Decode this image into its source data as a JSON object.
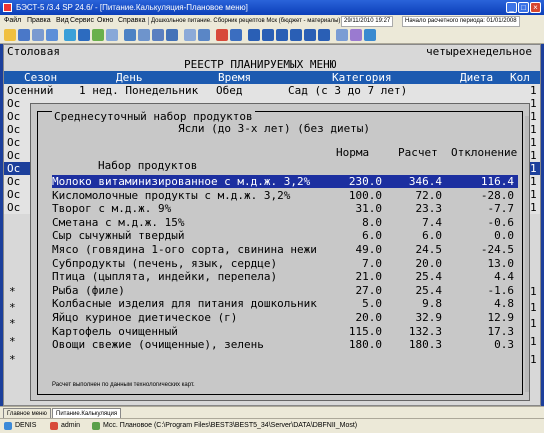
{
  "window": {
    "title": "БЭСТ-5 /3.4 SP 24.6/ - [Питание.Калькуляция-Плановое меню]"
  },
  "menu": {
    "items": [
      "Файл",
      "Правка",
      "Вид",
      "Сервис",
      "Окно",
      "Справка"
    ],
    "context": "Дошкольное питание. Сборник рецептов Мск (бюджет - материалы)",
    "date_info": "29/11/2010 19:27",
    "period_info": "Начало расчетного периода: 01/01/2008"
  },
  "header": {
    "left": "Столовая",
    "right": "четырехнедельное",
    "title": "РЕЕСТР ПЛАНИРУЕМЫХ МЕНЮ"
  },
  "columns": [
    "Сезон",
    "День",
    "Время",
    "Категория",
    "Диета",
    "Кол"
  ],
  "first_row": {
    "season": "Осенний",
    "day": "1 нед. Понедельник",
    "time": "Обед",
    "category": "Сад (с 3 до 7 лет)",
    "count": "1"
  },
  "bg_rows": [
    {
      "season": "Ос",
      "count": "1"
    },
    {
      "season": "Ос",
      "count": "1"
    },
    {
      "season": "Ос",
      "count": "1"
    },
    {
      "season": "Ос",
      "count": "1"
    },
    {
      "season": "Ос",
      "count": "1"
    },
    {
      "season": "Ос",
      "count": "1"
    },
    {
      "season": "Ос",
      "count": "1"
    },
    {
      "season": "Ос",
      "count": "1"
    },
    {
      "season": "Ос",
      "count": "1"
    }
  ],
  "star_rows": [
    {
      "mark": "*",
      "count": "1"
    },
    {
      "mark": "*",
      "count": "1"
    },
    {
      "mark": "*",
      "count": "1"
    },
    {
      "mark": "*",
      "count": "1"
    },
    {
      "mark": "*",
      "count": "1"
    }
  ],
  "dialog": {
    "title": "Среднесуточный набор продуктов",
    "subtitle": "Ясли (до 3-х лет) (без диеты)",
    "headers": {
      "name": "Набор продуктов",
      "norm": "Норма",
      "calc": "Расчет",
      "dev": "Отклонение"
    },
    "rows": [
      {
        "name": "Молоко витаминизированное с м.д.ж. 3,2%",
        "norm": "230.0",
        "calc": "346.4",
        "dev": "116.4"
      },
      {
        "name": "Кисломолочные продукты с м.д.ж. 3,2%",
        "norm": "100.0",
        "calc": "72.0",
        "dev": "-28.0"
      },
      {
        "name": "Творог с м.д.ж. 9%",
        "norm": "31.0",
        "calc": "23.3",
        "dev": "-7.7"
      },
      {
        "name": "Сметана с м.д.ж. 15%",
        "norm": "8.0",
        "calc": "7.4",
        "dev": "-0.6"
      },
      {
        "name": "Сыр сычужный твердый",
        "norm": "6.0",
        "calc": "6.0",
        "dev": "0.0"
      },
      {
        "name": "Мясо (говядина 1-ого сорта, свинина нежи",
        "norm": "49.0",
        "calc": "24.5",
        "dev": "-24.5"
      },
      {
        "name": "Субпродукты (печень, язык, сердце)",
        "norm": "7.0",
        "calc": "20.0",
        "dev": "13.0"
      },
      {
        "name": "Птица (цыплята, индейки, перепела)",
        "norm": "21.0",
        "calc": "25.4",
        "dev": "4.4"
      },
      {
        "name": "Рыба (филе)",
        "norm": "27.0",
        "calc": "25.4",
        "dev": "-1.6"
      },
      {
        "name": "Колбасные изделия для питания дошкольник",
        "norm": "5.0",
        "calc": "9.8",
        "dev": "4.8"
      },
      {
        "name": "Яйцо куриное диетическое (г)",
        "norm": "20.0",
        "calc": "32.9",
        "dev": "12.9"
      },
      {
        "name": "Картофель очищенный",
        "norm": "115.0",
        "calc": "132.3",
        "dev": "17.3"
      },
      {
        "name": "Овощи свежие (очищенные), зелень",
        "norm": "180.0",
        "calc": "180.3",
        "dev": "0.3"
      }
    ],
    "note": "Расчет выполнен по данным технологических карт."
  },
  "tabs": [
    "Главное меню",
    "Питание.Калькуляция"
  ],
  "status": {
    "user1": "DENIS",
    "user2": "admin",
    "path": "Мсс. Плановое (C:\\Program Files\\BEST3\\BEST5_34\\Server\\DATA\\DBFNII_Most)"
  },
  "colors": {
    "accent": "#1c3f9b",
    "selected_row": "#1c2fa0",
    "dialog_bg": "#c8c8c8"
  }
}
